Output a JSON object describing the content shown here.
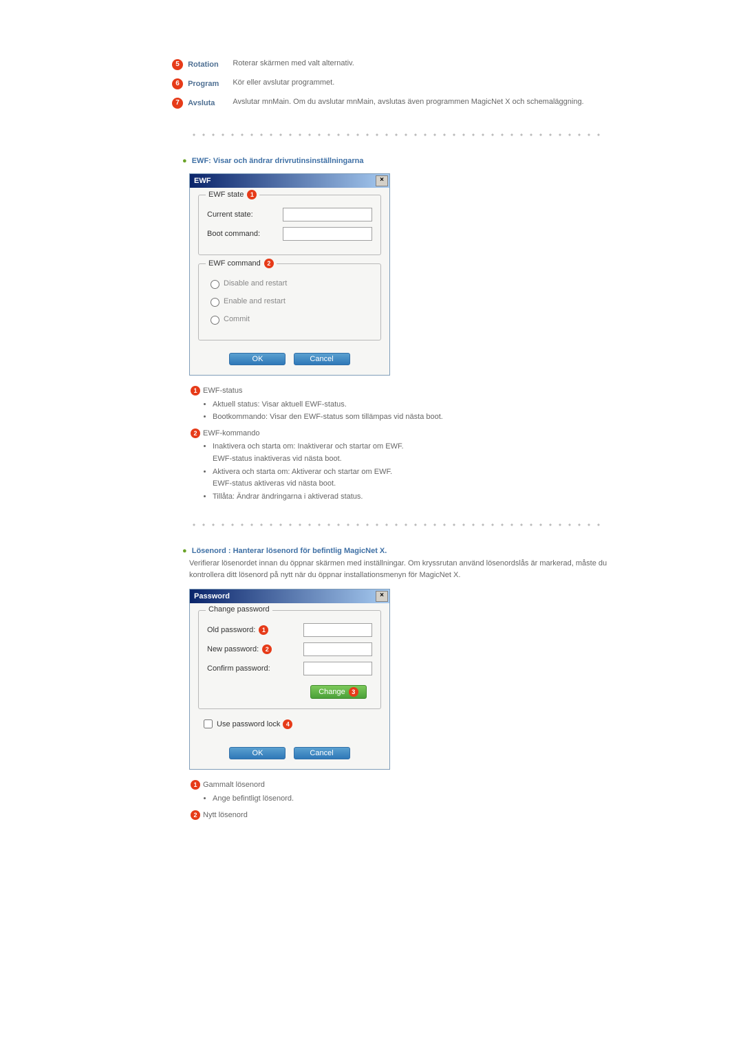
{
  "defs": {
    "rotation": {
      "term": "Rotation",
      "desc": "Roterar skärmen med valt alternativ.",
      "num": "5"
    },
    "program": {
      "term": "Program",
      "desc": "Kör eller avslutar programmet.",
      "num": "6"
    },
    "avsluta": {
      "term": "Avsluta",
      "desc": "Avslutar mnMain. Om du avslutar mnMain, avslutas även programmen MagicNet X och schemaläggning.",
      "num": "7"
    }
  },
  "ewf": {
    "heading": "EWF: Visar och ändrar drivrutinsinställningarna",
    "dialog_title": "EWF",
    "group_state": "EWF state",
    "current_state_label": "Current state:",
    "boot_command_label": "Boot command:",
    "group_command": "EWF command",
    "opt_disable": "Disable and restart",
    "opt_enable": "Enable and restart",
    "opt_commit": "Commit",
    "ok": "OK",
    "cancel": "Cancel",
    "explain": {
      "status_title": "EWF-status",
      "status_b1": "Aktuell status: Visar aktuell EWF-status.",
      "status_b2": "Bootkommando: Visar den EWF-status som tillämpas vid nästa boot.",
      "cmd_title": "EWF-kommando",
      "cmd_b1a": "Inaktivera och starta om: Inaktiverar och startar om EWF.",
      "cmd_b1b": "EWF-status inaktiveras vid nästa boot.",
      "cmd_b2a": "Aktivera och starta om: Aktiverar och startar om EWF.",
      "cmd_b2b": "EWF-status aktiveras vid nästa boot.",
      "cmd_b3": "Tillåta: Ändrar ändringarna i aktiverad status."
    }
  },
  "pwd": {
    "heading": "Lösenord : Hanterar lösenord för befintlig MagicNet X.",
    "sub": "Verifierar lösenordet innan du öppnar skärmen med inställningar. Om kryssrutan använd lösenordslås är markerad, måste du kontrollera ditt lösenord på nytt när du öppnar installationsmenyn för MagicNet X.",
    "dialog_title": "Password",
    "group": "Change password",
    "old_label": "Old password:",
    "new_label": "New password:",
    "confirm_label": "Confirm password:",
    "change_btn": "Change",
    "use_lock": "Use password lock",
    "ok": "OK",
    "cancel": "Cancel",
    "explain": {
      "old_title": "Gammalt lösenord",
      "old_b1": "Ange befintligt lösenord.",
      "new_title": "Nytt lösenord"
    }
  }
}
